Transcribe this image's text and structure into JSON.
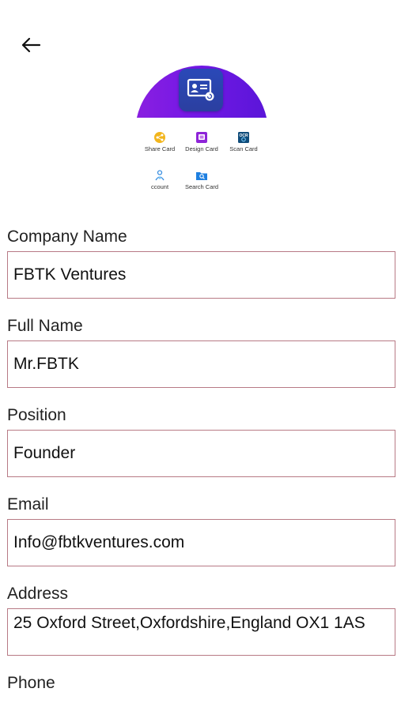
{
  "header": {
    "back_icon": "arrow-left-icon"
  },
  "hero": {
    "icon": "contact-card-icon",
    "accent": "#7a1ce6",
    "tile_color": "#2b45ad"
  },
  "features": [
    {
      "label": "Share Card",
      "icon": "share-icon",
      "color": "#f2b51c"
    },
    {
      "label": "Design Card",
      "icon": "design-icon",
      "color": "#8e24d8"
    },
    {
      "label": "Scan Card",
      "icon": "ocr-scan-icon",
      "color": "#0f4c7a"
    },
    {
      "label": "ccount",
      "icon": "account-icon",
      "color": "#3b8fe0"
    },
    {
      "label": "Search Card",
      "icon": "search-card-icon",
      "color": "#1e7fe0"
    }
  ],
  "form": {
    "company": {
      "label": "Company Name",
      "value": "FBTK Ventures"
    },
    "full_name": {
      "label": "Full Name",
      "value": "Mr.FBTK"
    },
    "position": {
      "label": "Position",
      "value": "Founder"
    },
    "email": {
      "label": "Email",
      "value": "Info@fbtkventures.com"
    },
    "address": {
      "label": "Address",
      "value": "25 Oxford Street,Oxfordshire,England OX1 1AS"
    },
    "phone": {
      "label": "Phone"
    }
  },
  "colors": {
    "field_border": "#b87a85"
  }
}
